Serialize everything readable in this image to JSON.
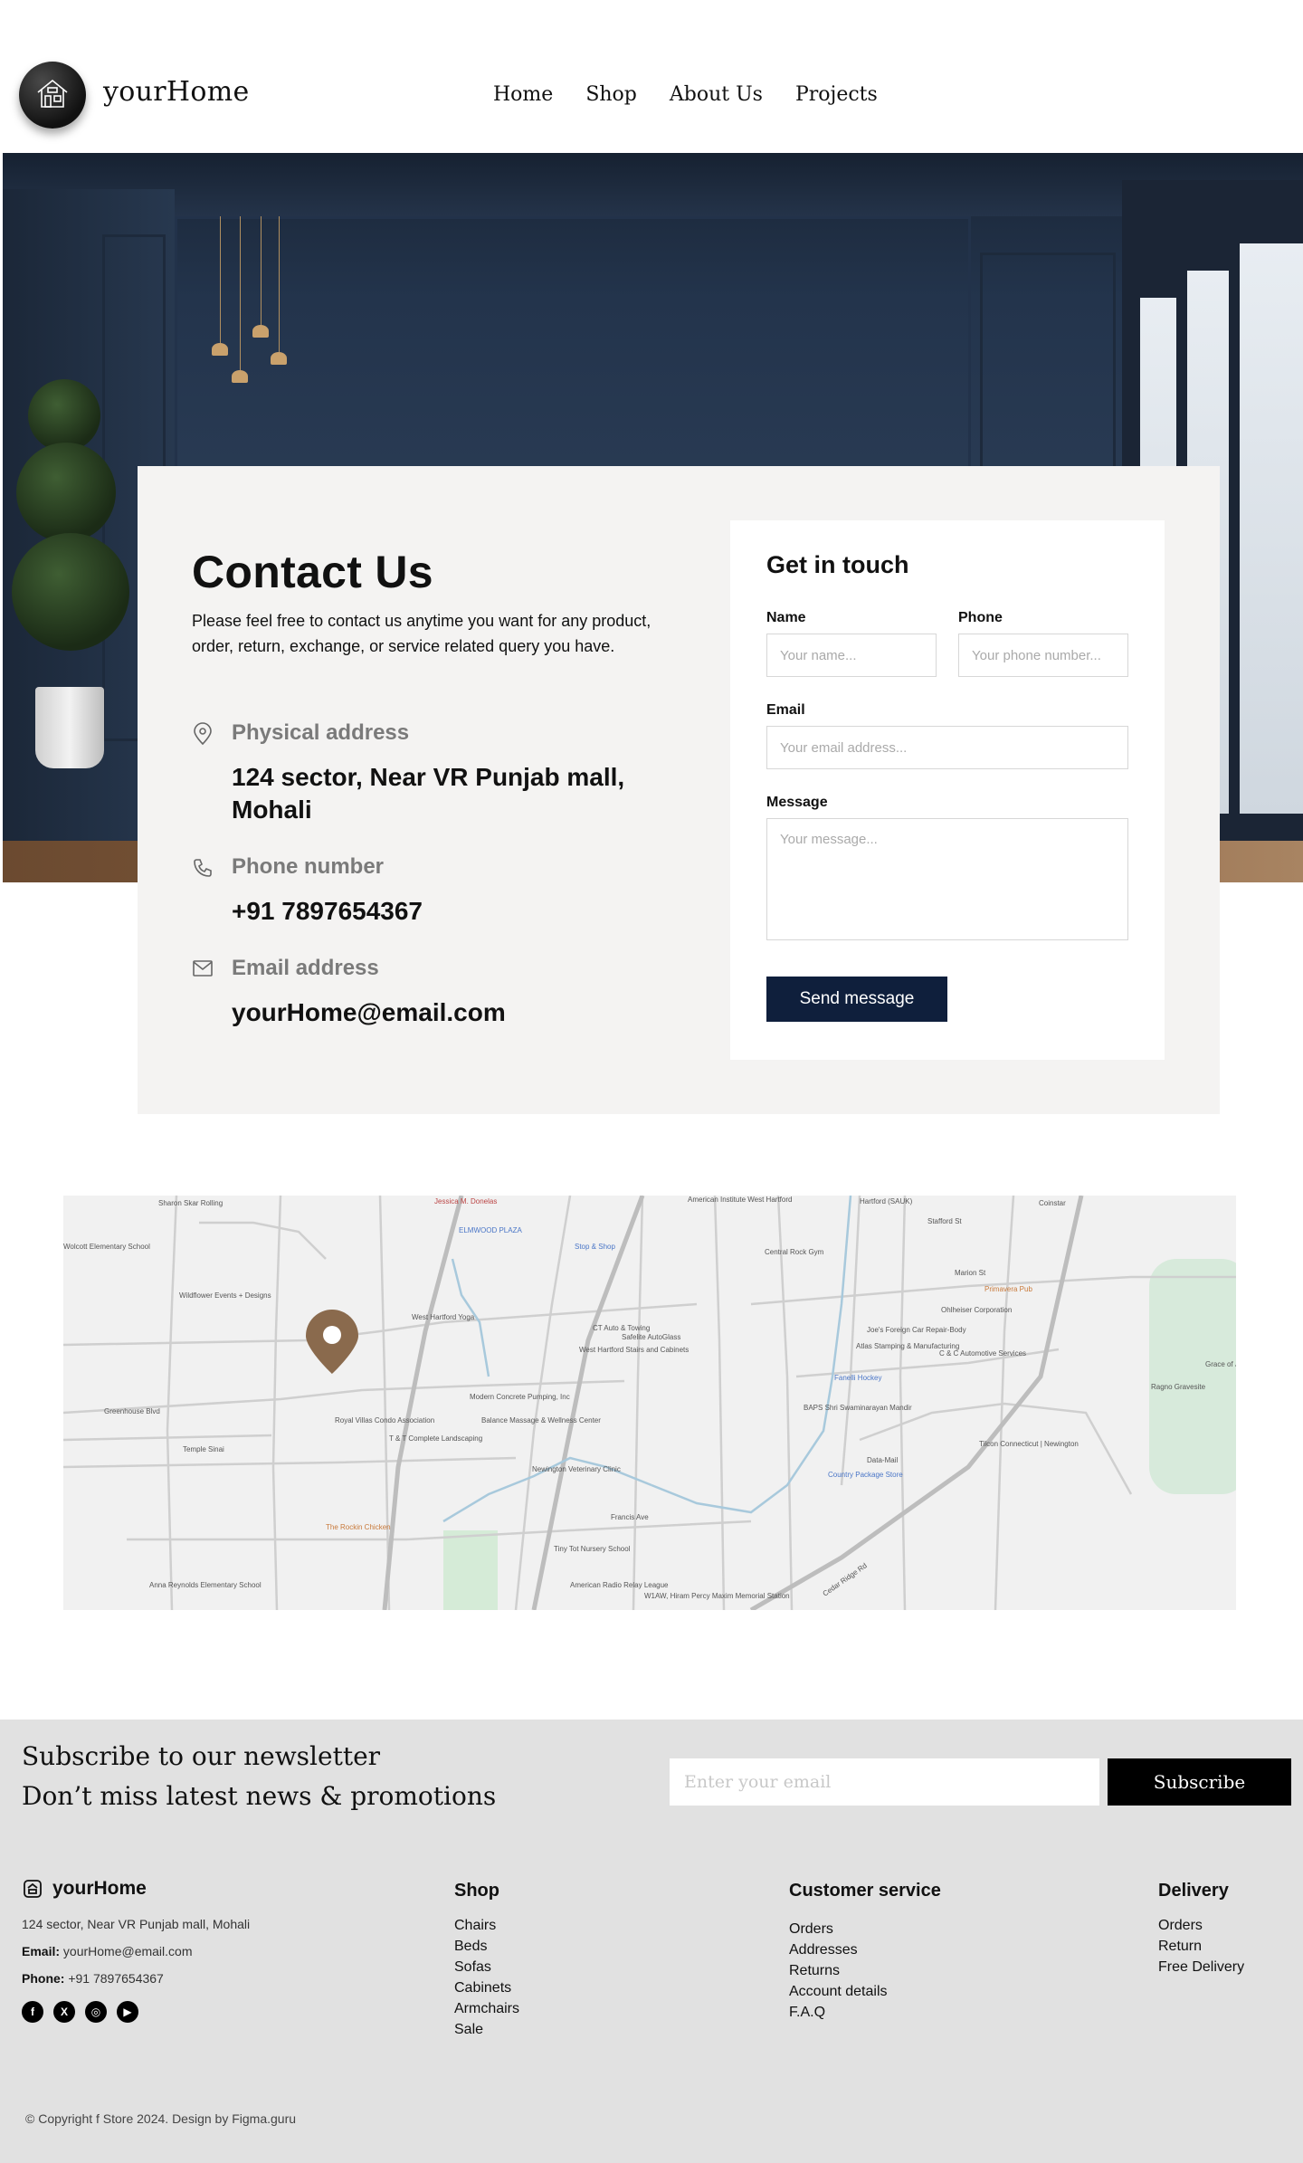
{
  "header": {
    "brand": "yourHome",
    "nav": [
      "Home",
      "Shop",
      "About Us",
      "Projects"
    ]
  },
  "contact": {
    "title": "Contact Us",
    "description": "Please feel free to contact us anytime you want for any product, order, return, exchange, or service related query you have.",
    "address_label": "Physical address",
    "address_value": "124 sector, Near VR Punjab mall, Mohali",
    "phone_label": "Phone number",
    "phone_value": "+91 7897654367",
    "email_label": "Email address",
    "email_value": "yourHome@email.com"
  },
  "form": {
    "title": "Get in touch",
    "name_label": "Name",
    "name_placeholder": "Your name...",
    "phone_label": "Phone",
    "phone_placeholder": "Your phone number...",
    "email_label": "Email",
    "email_placeholder": "Your email address...",
    "message_label": "Message",
    "message_placeholder": "Your message...",
    "submit_label": "Send message"
  },
  "map": {
    "labels": [
      "Sharon Skar Rolling",
      "Jessica M. Donelas",
      "American Institute West Hartford",
      "Hartford (SAUK)",
      "Stafford St",
      "Coinstar",
      "ELMWOOD PLAZA",
      "Stop & Shop",
      "Central Rock Gym",
      "Wolcott Elementary School",
      "Wildflower Events + Designs",
      "Primavera Pub",
      "Marion St",
      "Ohlheiser Corporation",
      "West Hartford Yoga",
      "CT Auto & Towing",
      "Safelite AutoGlass",
      "West Hartford Stairs and Cabinets",
      "Joe's Foreign Car Repair-Body",
      "Atlas Stamping & Manufacturing",
      "C & C Automotive Services",
      "Fanelli Hockey",
      "Grace of J",
      "Ragno Gravesite",
      "Greenhouse Blvd",
      "Modern Concrete Pumping, Inc",
      "Royal Villas Condo Association",
      "Balance Massage & Wellness Center",
      "BAPS Shri Swaminarayan Mandir",
      "Temple Sinai",
      "T & T Complete Landscaping",
      "Data-Mail",
      "Country Package Store",
      "Tilcon Connecticut | Newington",
      "Newington Veterinary Clinic",
      "The Rockin Chicken",
      "Tiny Tot Nursery School",
      "Anna Reynolds Elementary School",
      "American Radio Relay League",
      "W1AW, Hiram Percy Maxim Memorial Station",
      "Cedar Ridge Rd",
      "Francis Ave"
    ]
  },
  "newsletter": {
    "line1": "Subscribe to our newsletter",
    "line2": "Don’t miss latest news & promotions",
    "placeholder": "Enter your email",
    "button": "Subscribe"
  },
  "footer": {
    "brand": "yourHome",
    "address": "124 sector, Near VR Punjab mall, Mohali",
    "email_key": "Email:",
    "email_value": "yourHome@email.com",
    "phone_key": "Phone:",
    "phone_value": "+91 7897654367",
    "socials": [
      "f",
      "X",
      "◎",
      "▶"
    ],
    "shop_title": "Shop",
    "shop_items": [
      "Chairs",
      "Beds",
      "Sofas",
      "Cabinets",
      "Armchairs",
      "Sale"
    ],
    "service_title": "Customer service",
    "service_items": [
      "Orders",
      "Addresses",
      "Returns",
      "Account details",
      "F.A.Q"
    ],
    "delivery_title": "Delivery",
    "delivery_items": [
      "Orders",
      "Return",
      "Free Delivery"
    ],
    "copyright": "© Copyright f Store 2024. Design by Figma.guru"
  },
  "colors": {
    "accent_dark": "#0f1f3c",
    "card_bg": "#f4f3f2",
    "footer_bg": "#e1e1e1",
    "pin": "#8a6a4d"
  },
  "icons": [
    "house-logo-icon",
    "location-pin-icon",
    "phone-icon",
    "mail-icon",
    "map-marker-icon",
    "facebook-icon",
    "x-icon",
    "instagram-icon",
    "youtube-icon"
  ]
}
